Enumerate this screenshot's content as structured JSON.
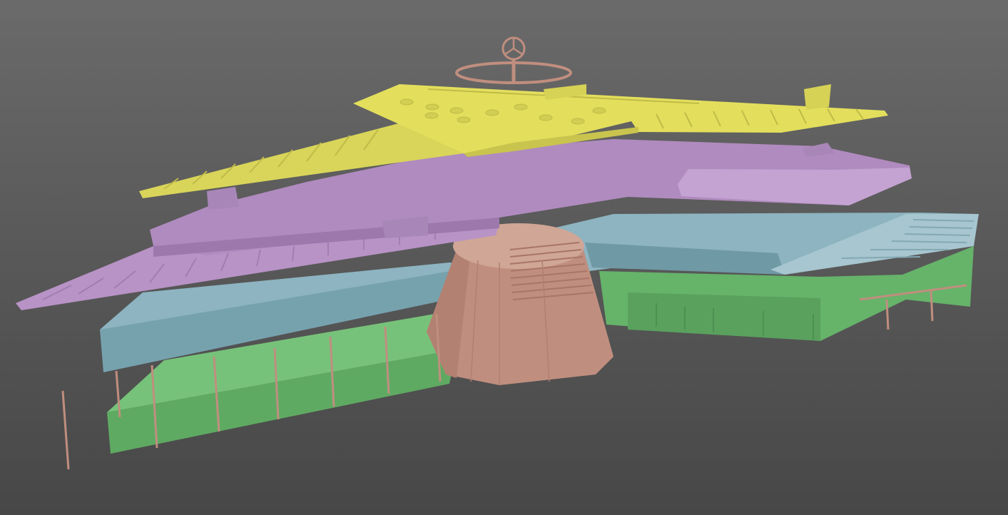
{
  "viewport": {
    "background_top": "#6a6a6a",
    "background_bottom": "#474747"
  },
  "model": {
    "layers": [
      {
        "name": "roof",
        "color": "#e3df5c"
      },
      {
        "name": "upper-deck",
        "color": "#b996c8"
      },
      {
        "name": "middle-deck",
        "color": "#7fa7b3"
      },
      {
        "name": "ground-floor",
        "color": "#6fba73"
      },
      {
        "name": "core-tower-and-columns",
        "color": "#c89a8a"
      }
    ],
    "rooftop_emblem_icon": "three-pointed-star-icon"
  }
}
